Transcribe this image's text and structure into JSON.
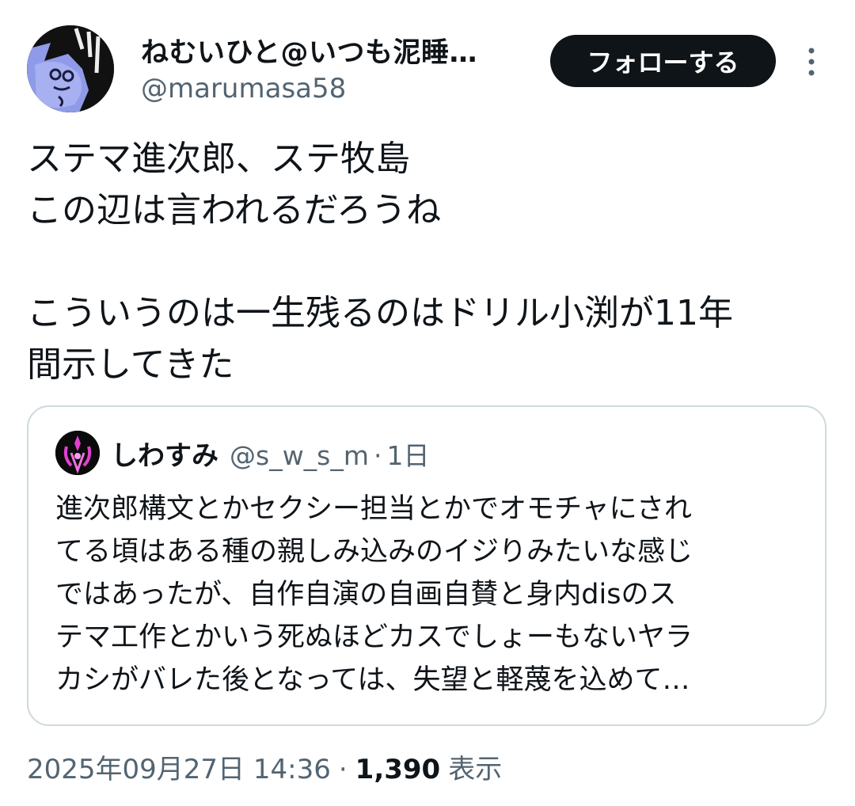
{
  "author": {
    "display_name": "ねむいひと@いつも泥睡…",
    "handle": "@marumasa58",
    "avatar_icon": "blue-creature-avatar"
  },
  "follow_button_label": "フォローする",
  "more_icon": "more-vertical-icon",
  "tweet": {
    "text": "ステマ進次郎、ステ牧島\nこの辺は言われるだろうね\n\nこういうのは一生残るのはドリル小渕が11年\n間示してきた"
  },
  "quote": {
    "display_name": "しわすみ",
    "handle": "@s_w_s_m",
    "separator": "·",
    "time": "1日",
    "avatar_icon": "pink-emblem-avatar",
    "text": "進次郎構文とかセクシー担当とかでオモチャにされ\nてる頃はある種の親しみ込みのイジりみたいな感じ\nではあったが、自作自演の自画自賛と身内disのス\nテマ工作とかいう死ぬほどカスでしょーもないヤラ\nカシがバレた後となっては、失望と軽蔑を込めて…"
  },
  "meta": {
    "timestamp": "2025年09月27日 14:36",
    "separator": "·",
    "views_count": "1,390",
    "views_label": "表示"
  },
  "colors": {
    "text_primary": "#0f1419",
    "text_secondary": "#536471",
    "border": "#cfd9de",
    "button_bg": "#0f1419"
  }
}
